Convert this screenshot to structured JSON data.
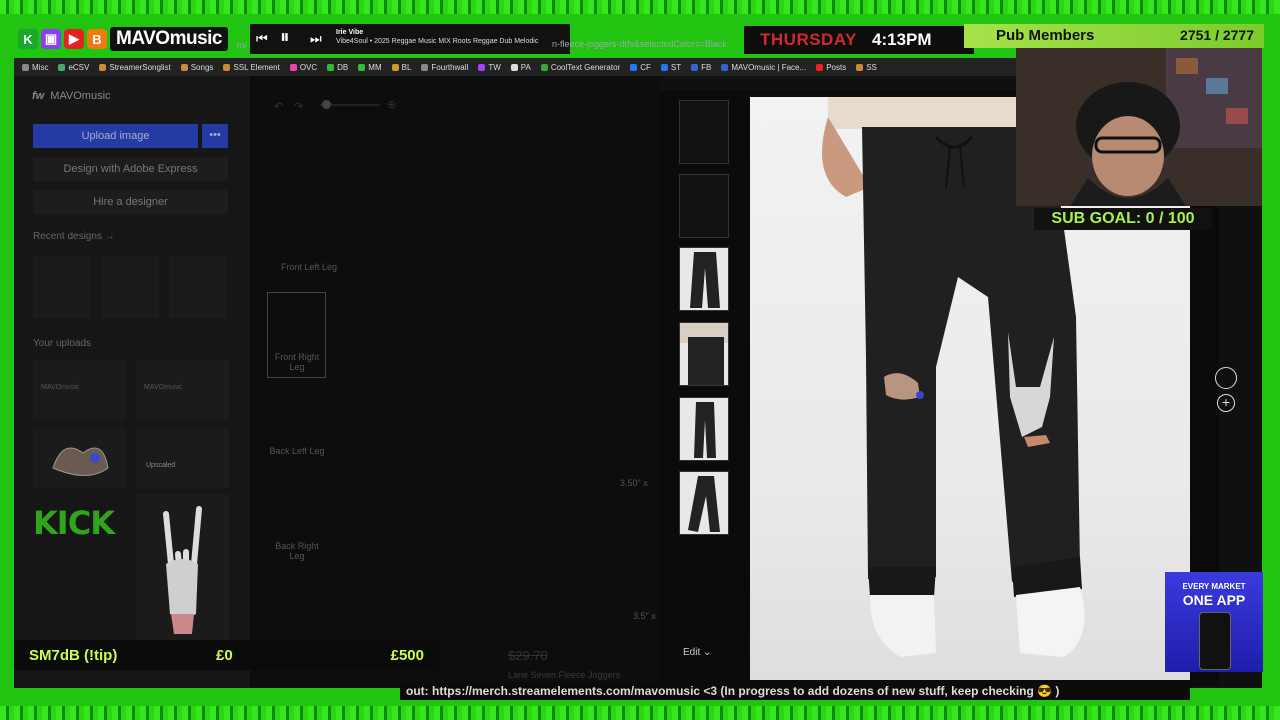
{
  "overlay": {
    "logo_text": "MAVOmusic",
    "music": {
      "title": "Irie Vibe",
      "artist": "Vibe4Soul • 2025 Reggae Music MIX Roots Reggae Dub Melodic"
    },
    "url_fragment": "n-fleece-joggers-dtfx&selectedColors=Black",
    "url_prefix": "m/",
    "day": "THURSDAY",
    "time": "4:13PM",
    "pub_label": "Pub Members",
    "pub_count": "2751 / 2777",
    "sub_goal": "SUB GOAL: 0 / 100",
    "tip_name": "SM7dB (!tip)",
    "tip_low": "£0",
    "tip_high": "£500",
    "ticker": "out: https://merch.streamelements.com/mavomusic <3 (In progress to add dozens of new stuff, keep checking 😎 )",
    "ad_line1": "EVERY MARKET",
    "ad_line2": "ONE APP"
  },
  "bookmarks": [
    {
      "label": "Misc",
      "color": "#888"
    },
    {
      "label": "eCSV",
      "color": "#4a7"
    },
    {
      "label": "StreamerSonglist",
      "color": "#c83"
    },
    {
      "label": "Songs",
      "color": "#c83"
    },
    {
      "label": "SSL Element",
      "color": "#c83"
    },
    {
      "label": "OVC",
      "color": "#e4a"
    },
    {
      "label": "DB",
      "color": "#3b3"
    },
    {
      "label": "MM",
      "color": "#3b3"
    },
    {
      "label": "BL",
      "color": "#c92"
    },
    {
      "label": "Fourthwall",
      "color": "#888"
    },
    {
      "label": "TW",
      "color": "#94f"
    },
    {
      "label": "PA",
      "color": "#ddd"
    },
    {
      "label": "CoolText Generator",
      "color": "#3a3"
    },
    {
      "label": "CF",
      "color": "#27f"
    },
    {
      "label": "ST",
      "color": "#27f"
    },
    {
      "label": "FB",
      "color": "#36c"
    },
    {
      "label": "MAVOmusic | Face...",
      "color": "#36c"
    },
    {
      "label": "Posts",
      "color": "#e22"
    },
    {
      "label": "SS",
      "color": "#c83"
    }
  ],
  "sidebar": {
    "brand": "MAVOmusic",
    "brand_mark": "fw",
    "upload_label": "Upload image",
    "more_label": "•••",
    "adobe_label": "Design with Adobe Express",
    "hire_label": "Hire a designer",
    "recent_label": "Recent designs →",
    "uploads_label": "Your uploads",
    "upload_thumb_1": "MAVOmusic",
    "upload_thumb_2": "MAVOmusic",
    "upscaled_label": "Upscaled",
    "kick_label": "KICK"
  },
  "canvas": {
    "parts": [
      "Front Left Leg",
      "Front Right Leg",
      "Back Left Leg",
      "Back Right Leg"
    ],
    "dim1": "3.50\" x",
    "dim2": "3.5\" x",
    "price": "$29.70",
    "product": "Lane Seven Fleece Joggers"
  },
  "preview": {
    "edit_label": "Edit"
  }
}
